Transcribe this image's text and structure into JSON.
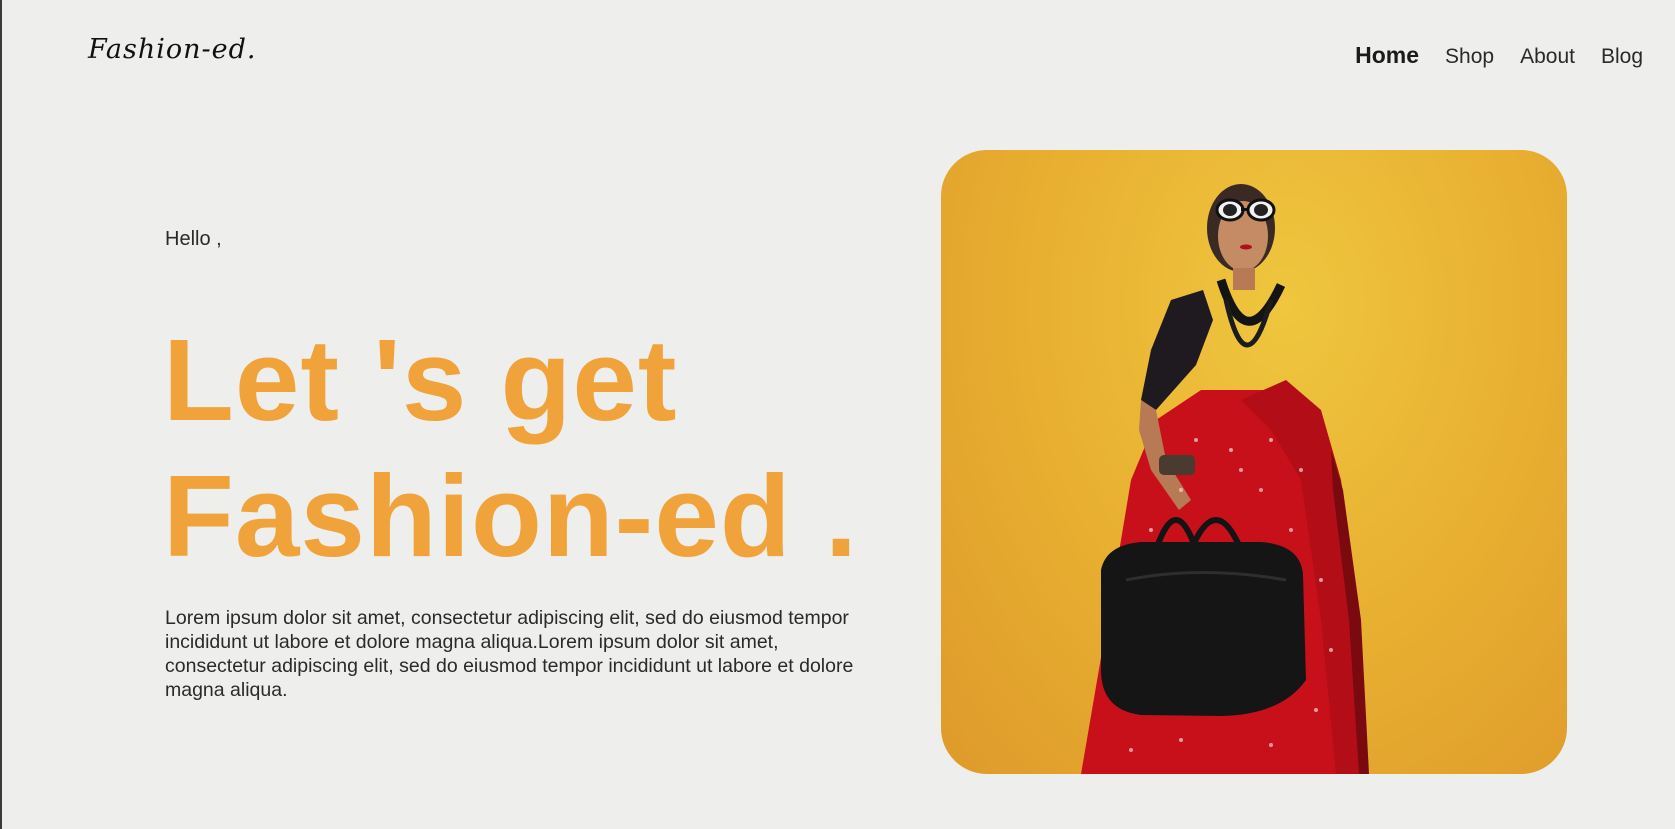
{
  "brand": {
    "logo_text": "Fashion-ed."
  },
  "nav": {
    "items": [
      {
        "label": "Home",
        "active": true
      },
      {
        "label": "Shop",
        "active": false
      },
      {
        "label": "About",
        "active": false
      },
      {
        "label": "Blog",
        "active": false
      }
    ]
  },
  "hero": {
    "greeting": "Hello ,",
    "headline_line1": "Let 's get",
    "headline_line2": "Fashion-ed .",
    "body": "Lorem ipsum dolor sit amet, consectetur adipiscing elit, sed do eiusmod tempor incididunt ut labore et dolore magna aliqua.Lorem ipsum dolor sit amet, consectetur adipiscing elit, sed do eiusmod tempor incididunt ut labore et dolore magna aliqua.",
    "image_alt": "model in red saree with black handbag on yellow background"
  },
  "colors": {
    "background": "#eeeeec",
    "accent": "#f0a33b",
    "text": "#2a2a2a",
    "image_bg": "#e9b232"
  }
}
